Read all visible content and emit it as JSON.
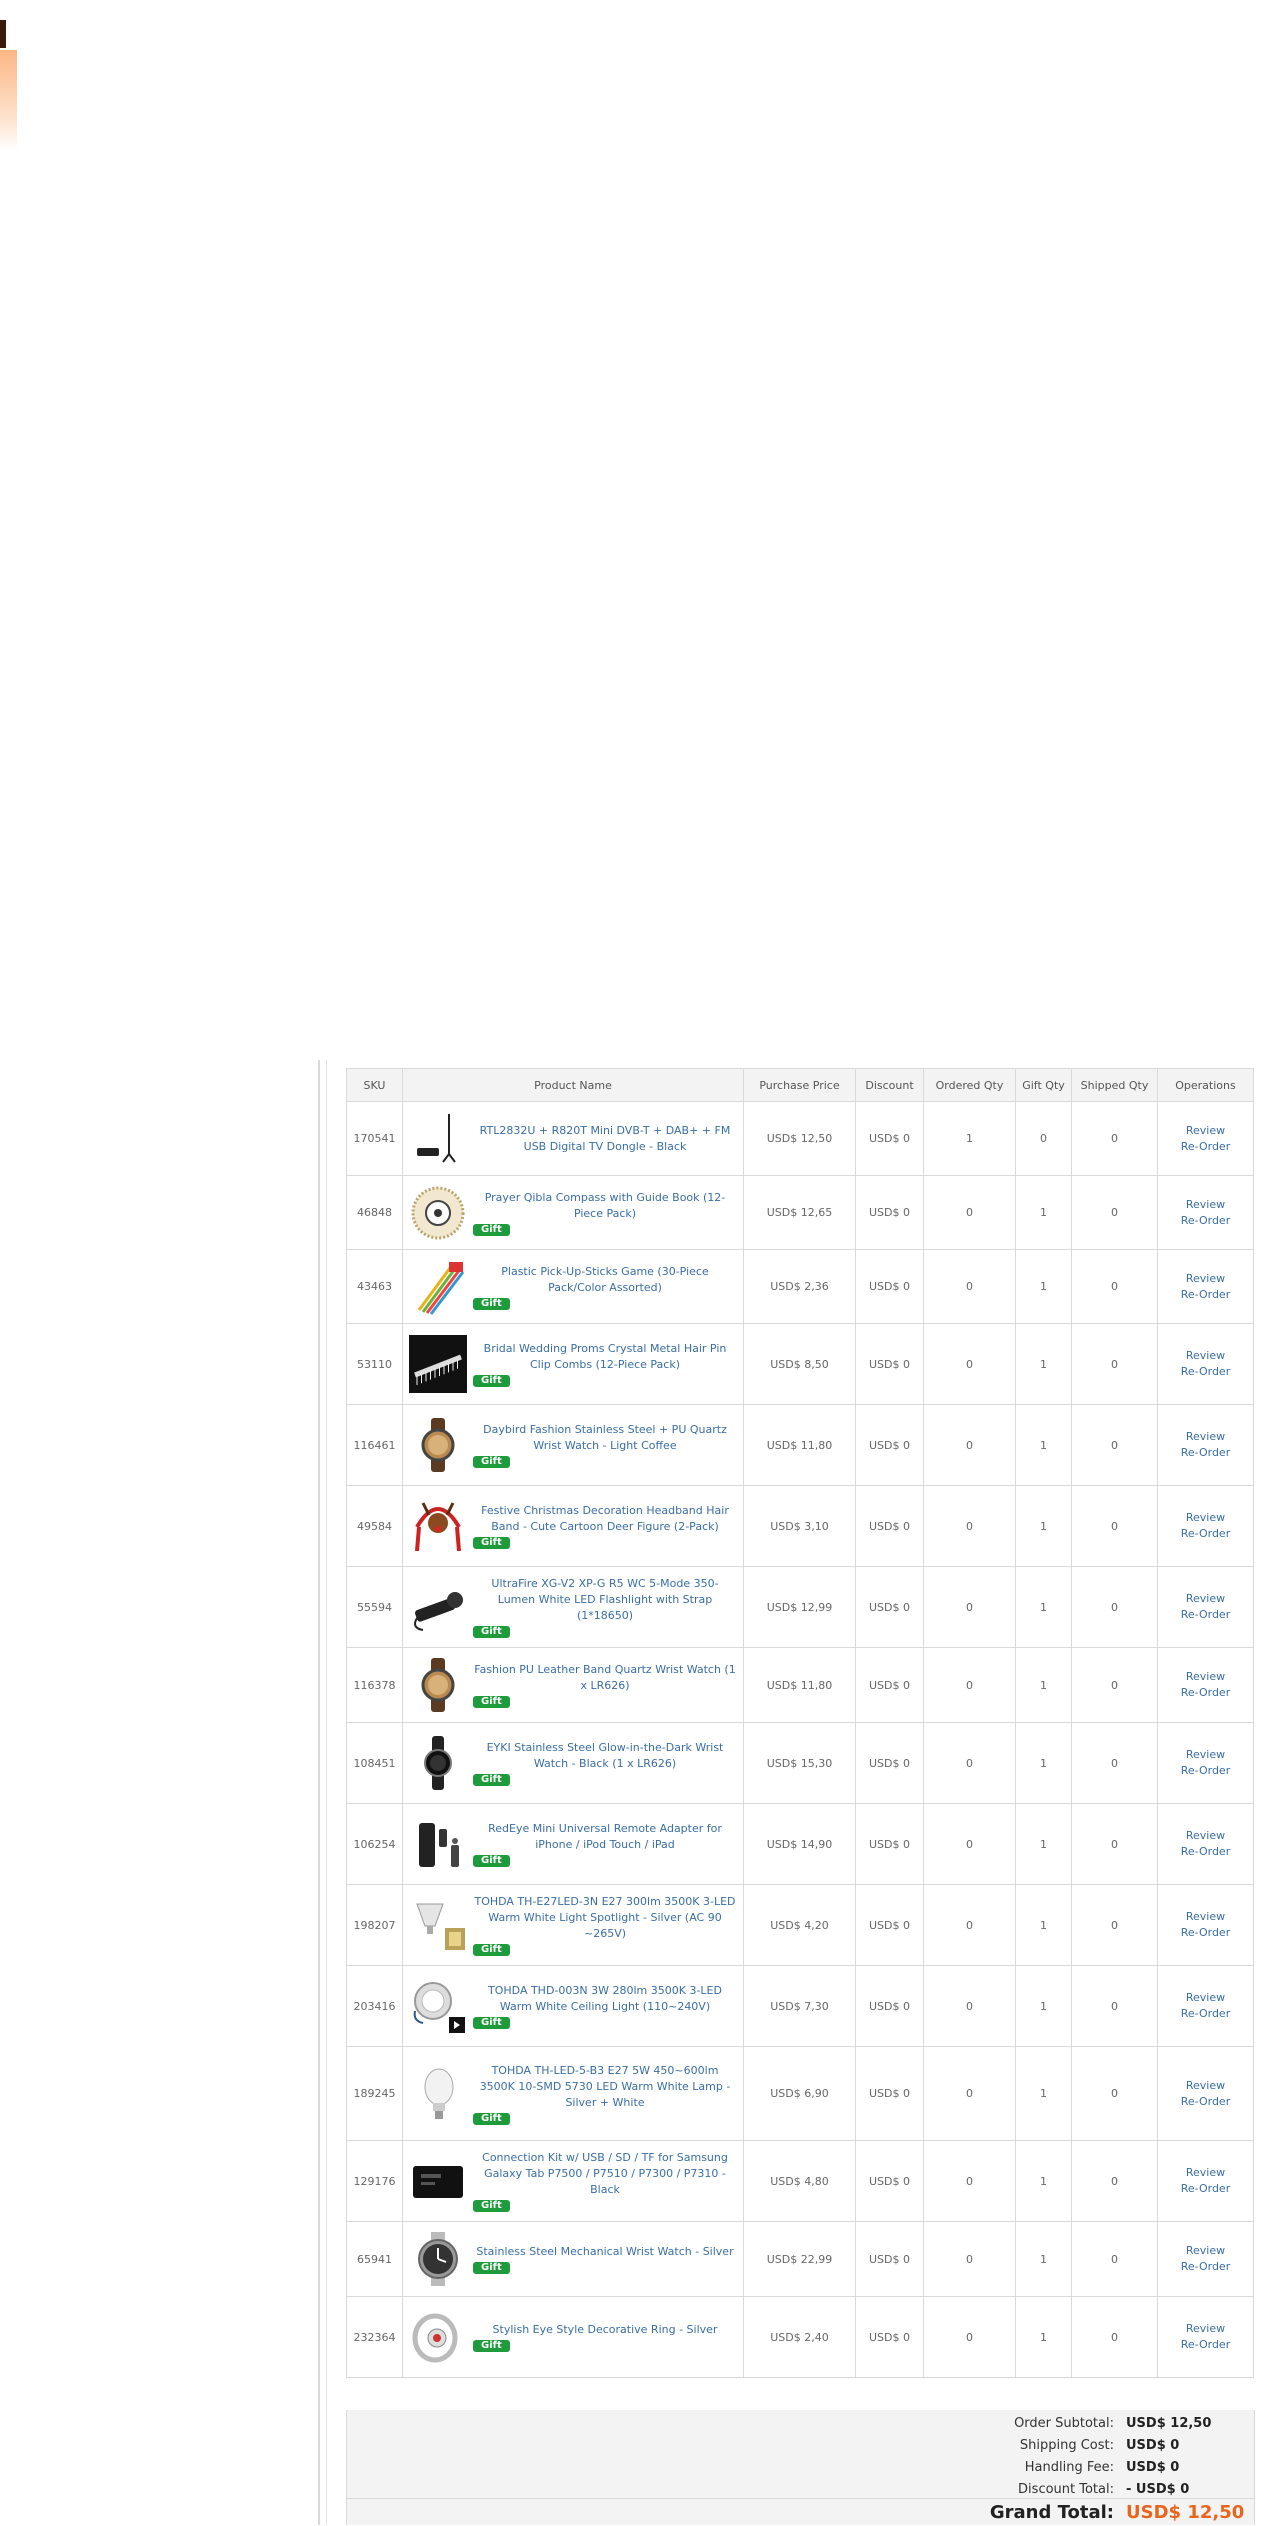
{
  "table": {
    "headers": {
      "sku": "SKU",
      "product_name": "Product Name",
      "purchase_price": "Purchase Price",
      "discount": "Discount",
      "ordered_qty": "Ordered Qty",
      "gift_qty": "Gift Qty",
      "shipped_qty": "Shipped Qty",
      "operations": "Operations"
    },
    "gift_label": "Gift",
    "review_label": "Review",
    "reorder_label": "Re-Order",
    "rows": [
      {
        "sku": "170541",
        "name": "RTL2832U + R820T Mini DVB-T + DAB+ + FM USB Digital TV Dongle - Black",
        "price": "USD$ 12,50",
        "discount": "USD$ 0",
        "ordered": "1",
        "gift": "0",
        "shipped": "0",
        "is_gift": false,
        "icon": "tv-dongle-icon"
      },
      {
        "sku": "46848",
        "name": "Prayer Qibla Compass with Guide Book (12-Piece Pack)",
        "price": "USD$ 12,65",
        "discount": "USD$ 0",
        "ordered": "0",
        "gift": "1",
        "shipped": "0",
        "is_gift": true,
        "icon": "compass-icon"
      },
      {
        "sku": "43463",
        "name": "Plastic Pick-Up-Sticks Game (30-Piece Pack/Color Assorted)",
        "price": "USD$ 2,36",
        "discount": "USD$ 0",
        "ordered": "0",
        "gift": "1",
        "shipped": "0",
        "is_gift": true,
        "icon": "sticks-icon"
      },
      {
        "sku": "53110",
        "name": "Bridal Wedding Proms Crystal Metal Hair Pin Clip Combs (12-Piece Pack)",
        "price": "USD$ 8,50",
        "discount": "USD$ 0",
        "ordered": "0",
        "gift": "1",
        "shipped": "0",
        "is_gift": true,
        "icon": "hair-clip-icon"
      },
      {
        "sku": "116461",
        "name": "Daybird Fashion Stainless Steel + PU Quartz Wrist Watch - Light Coffee",
        "price": "USD$ 11,80",
        "discount": "USD$ 0",
        "ordered": "0",
        "gift": "1",
        "shipped": "0",
        "is_gift": true,
        "icon": "watch-icon"
      },
      {
        "sku": "49584",
        "name": "Festive Christmas Decoration Headband Hair Band - Cute Cartoon Deer Figure (2-Pack)",
        "price": "USD$ 3,10",
        "discount": "USD$ 0",
        "ordered": "0",
        "gift": "1",
        "shipped": "0",
        "is_gift": true,
        "icon": "reindeer-headband-icon"
      },
      {
        "sku": "55594",
        "name": "UltraFire XG-V2 XP-G R5 WC 5-Mode 350-Lumen White LED Flashlight with Strap (1*18650)",
        "price": "USD$ 12,99",
        "discount": "USD$ 0",
        "ordered": "0",
        "gift": "1",
        "shipped": "0",
        "is_gift": true,
        "icon": "flashlight-icon"
      },
      {
        "sku": "116378",
        "name": "Fashion PU Leather Band Quartz Wrist Watch (1 x LR626)",
        "price": "USD$ 11,80",
        "discount": "USD$ 0",
        "ordered": "0",
        "gift": "1",
        "shipped": "0",
        "is_gift": true,
        "icon": "watch-icon"
      },
      {
        "sku": "108451",
        "name": "EYKI Stainless Steel Glow-in-the-Dark Wrist Watch - Black (1 x LR626)",
        "price": "USD$ 15,30",
        "discount": "USD$ 0",
        "ordered": "0",
        "gift": "1",
        "shipped": "0",
        "is_gift": true,
        "icon": "black-watch-icon"
      },
      {
        "sku": "106254",
        "name": "RedEye Mini Universal Remote Adapter for iPhone / iPod Touch / iPad",
        "price": "USD$ 14,90",
        "discount": "USD$ 0",
        "ordered": "0",
        "gift": "1",
        "shipped": "0",
        "is_gift": true,
        "icon": "remote-adapter-icon"
      },
      {
        "sku": "198207",
        "name": "TOHDA TH-E27LED-3N E27 300lm 3500K 3-LED Warm White Light Spotlight - Silver (AC 90 ~265V)",
        "price": "USD$ 4,20",
        "discount": "USD$ 0",
        "ordered": "0",
        "gift": "1",
        "shipped": "0",
        "is_gift": true,
        "icon": "spotlight-bulb-icon"
      },
      {
        "sku": "203416",
        "name": "TOHDA THD-003N 3W 280lm 3500K 3-LED Warm White Ceiling Light (110~240V)",
        "price": "USD$ 7,30",
        "discount": "USD$ 0",
        "ordered": "0",
        "gift": "1",
        "shipped": "0",
        "is_gift": true,
        "icon": "ceiling-light-icon"
      },
      {
        "sku": "189245",
        "name": "TOHDA TH-LED-5-B3 E27 5W 450~600lm 3500K 10-SMD 5730 LED Warm White Lamp - Silver + White",
        "price": "USD$ 6,90",
        "discount": "USD$ 0",
        "ordered": "0",
        "gift": "1",
        "shipped": "0",
        "is_gift": true,
        "icon": "led-bulb-icon"
      },
      {
        "sku": "129176",
        "name": "Connection Kit w/ USB / SD / TF for Samsung Galaxy Tab P7500 / P7510 / P7300 / P7310 - Black",
        "price": "USD$ 4,80",
        "discount": "USD$ 0",
        "ordered": "0",
        "gift": "1",
        "shipped": "0",
        "is_gift": true,
        "icon": "card-reader-icon"
      },
      {
        "sku": "65941",
        "name": "Stainless Steel Mechanical Wrist Watch - Silver",
        "price": "USD$ 22,99",
        "discount": "USD$ 0",
        "ordered": "0",
        "gift": "1",
        "shipped": "0",
        "is_gift": true,
        "icon": "silver-watch-icon"
      },
      {
        "sku": "232364",
        "name": "Stylish Eye Style Decorative Ring - Silver",
        "price": "USD$ 2,40",
        "discount": "USD$ 0",
        "ordered": "0",
        "gift": "1",
        "shipped": "0",
        "is_gift": true,
        "icon": "ring-icon"
      }
    ]
  },
  "summary": {
    "subtotal_label": "Order Subtotal:",
    "subtotal_value": "USD$ 12,50",
    "shipping_label": "Shipping Cost:",
    "shipping_value": "USD$ 0",
    "handling_label": "Handling Fee:",
    "handling_value": "USD$ 0",
    "discount_label": "Discount Total:",
    "discount_value": "- USD$ 0",
    "grand_label": "Grand Total:",
    "grand_value": "USD$ 12,50"
  },
  "colors": {
    "link": "#3a6ea5",
    "gift_badge": "#1e9c3c",
    "grand_total": "#e8651b"
  }
}
